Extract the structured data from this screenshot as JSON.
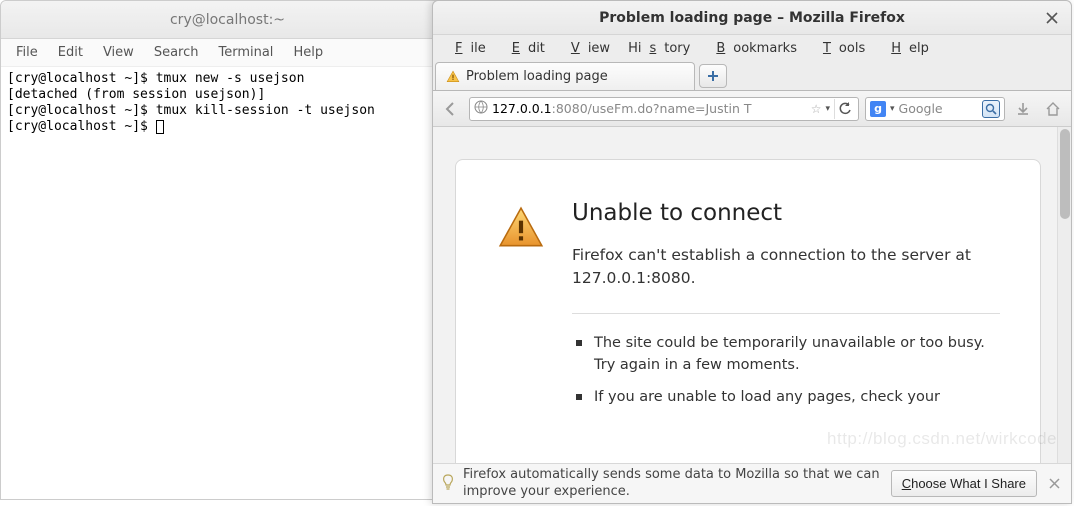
{
  "terminal": {
    "title": "cry@localhost:~",
    "menu": [
      "File",
      "Edit",
      "View",
      "Search",
      "Terminal",
      "Help"
    ],
    "lines": [
      "[cry@localhost ~]$ tmux new -s usejson",
      "[detached (from session usejson)]",
      "[cry@localhost ~]$ tmux kill-session -t usejson",
      "[cry@localhost ~]$ "
    ]
  },
  "firefox": {
    "title": "Problem loading page – Mozilla Firefox",
    "menu": [
      "File",
      "Edit",
      "View",
      "History",
      "Bookmarks",
      "Tools",
      "Help"
    ],
    "tab_label": "Problem loading page",
    "url_host": "127.0.0.1",
    "url_rest": ":8080/useFm.do?name=Justin T",
    "search_placeholder": "Google",
    "error": {
      "title": "Unable to connect",
      "sub": "Firefox can't establish a connection to the server at 127.0.0.1:8080.",
      "bullets": [
        "The site could be temporarily unavailable or too busy. Try again in a few moments.",
        "If you are unable to load any pages, check your"
      ]
    },
    "infobar": {
      "text": "Firefox automatically sends some data to Mozilla so that we can improve your experience.",
      "button": "Choose What I Share"
    }
  },
  "watermark": "http://blog.csdn.net/wirkcode"
}
